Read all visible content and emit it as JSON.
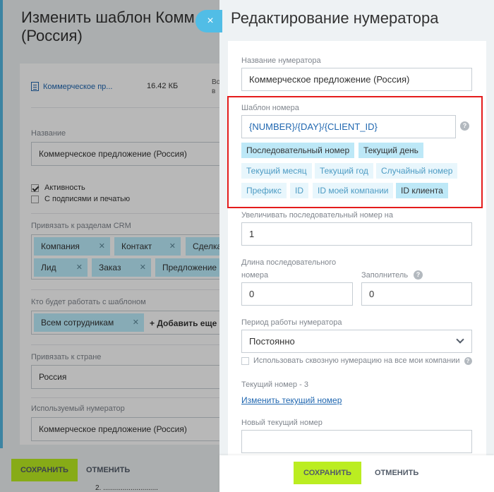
{
  "background": {
    "title": "Изменить шаблон Комм (Россия)",
    "file_name": "Коммерческое пр...",
    "file_size": "16.42 КБ",
    "file_version": "Во в",
    "name_label": "Название",
    "name_value": "Коммерческое предложение (Россия)",
    "active_label": "Активность",
    "signatures_label": "С подписями и печатью",
    "crm_label": "Привязать к разделам CRM",
    "crm_tags": [
      "Компания",
      "Контакт",
      "Сделка",
      "Лид",
      "Заказ",
      "Предложение"
    ],
    "who_label": "Кто будет работать с шаблоном",
    "who_tag": "Всем сотрудникам",
    "add_more": "+ Добавить еще",
    "country_label": "Привязать к стране",
    "country_value": "Россия",
    "numerator_label": "Используемый нумератор",
    "numerator_value": "Коммерческое предложение (Россия)",
    "save": "СОХРАНИТЬ",
    "cancel": "ОТМЕНИТЬ",
    "bottom_text": "2. ............................"
  },
  "close_icon": "×",
  "slider": {
    "title": "Редактирование нумератора",
    "name_label": "Название нумератора",
    "name_value": "Коммерческое предложение (Россия)",
    "template_label": "Шаблон номера",
    "template_value": "{NUMBER}/{DAY}/{CLIENT_ID}",
    "help_glyph": "?",
    "chips": [
      {
        "label": "Последовательный номер",
        "active": true
      },
      {
        "label": "Текущий день",
        "active": true
      },
      {
        "label": "Текущий месяц",
        "active": false
      },
      {
        "label": "Текущий год",
        "active": false
      },
      {
        "label": "Случайный номер",
        "active": false
      },
      {
        "label": "Префикс",
        "active": false
      },
      {
        "label": "ID",
        "active": false
      },
      {
        "label": "ID моей компании",
        "active": false
      },
      {
        "label": "ID клиента",
        "active": true
      }
    ],
    "increment_label": "Увеличивать последовательный номер на",
    "increment_value": "1",
    "length_label_1": "Длина последовательного",
    "length_label_2": "номера",
    "length_value": "0",
    "filler_label": "Заполнитель",
    "filler_value": "0",
    "period_label": "Период работы нумератора",
    "period_value": "Постоянно",
    "cross_numbering_label": "Использовать сквозную нумерацию на все мои компании",
    "current_number_label": "Текущий номер - 3",
    "change_current_link": "Изменить текущий номер",
    "new_current_label": "Новый текущий номер",
    "new_current_value": "",
    "save": "СОХРАНИТЬ",
    "cancel": "ОТМЕНИТЬ"
  },
  "colors": {
    "accent_blue": "#51bde6",
    "save_green": "#bbed21",
    "highlight_red": "#e41c1c",
    "link_blue": "#2067b0"
  }
}
